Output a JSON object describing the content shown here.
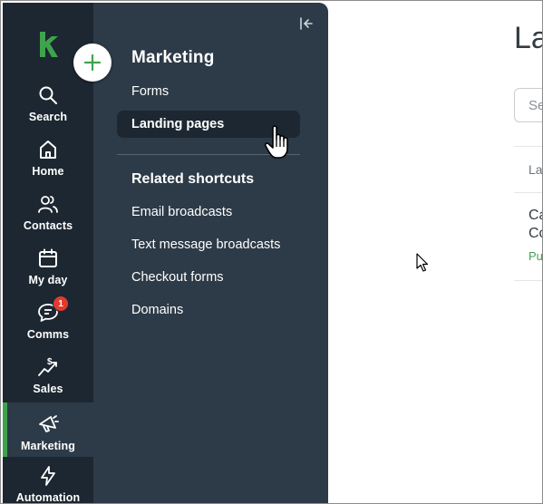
{
  "rail": {
    "items": [
      {
        "label": "Search",
        "icon": "search-icon"
      },
      {
        "label": "Home",
        "icon": "home-icon"
      },
      {
        "label": "Contacts",
        "icon": "contacts-icon"
      },
      {
        "label": "My day",
        "icon": "calendar-icon"
      },
      {
        "label": "Comms",
        "icon": "chat-icon",
        "badge": "1"
      },
      {
        "label": "Sales",
        "icon": "sales-icon"
      },
      {
        "label": "Marketing",
        "icon": "megaphone-icon",
        "active": true
      },
      {
        "label": "Automation",
        "icon": "lightning-icon"
      }
    ]
  },
  "panel": {
    "title": "Marketing",
    "links": [
      "Forms",
      "Landing pages"
    ],
    "selected": "Landing pages",
    "section_title": "Related shortcuts",
    "shortcuts": [
      "Email broadcasts",
      "Text message broadcasts",
      "Checkout forms",
      "Domains"
    ]
  },
  "main": {
    "title_partial": "La",
    "search_placeholder_partial": "Se",
    "column_header_partial": "La",
    "row": {
      "name_line1": "Ca",
      "name_line2": "Co",
      "status_partial": "Pu"
    }
  },
  "colors": {
    "rail_bg": "#1c2731",
    "panel_bg": "#2d3a47",
    "accent_green": "#3fa34d",
    "badge_red": "#e03b2f"
  }
}
